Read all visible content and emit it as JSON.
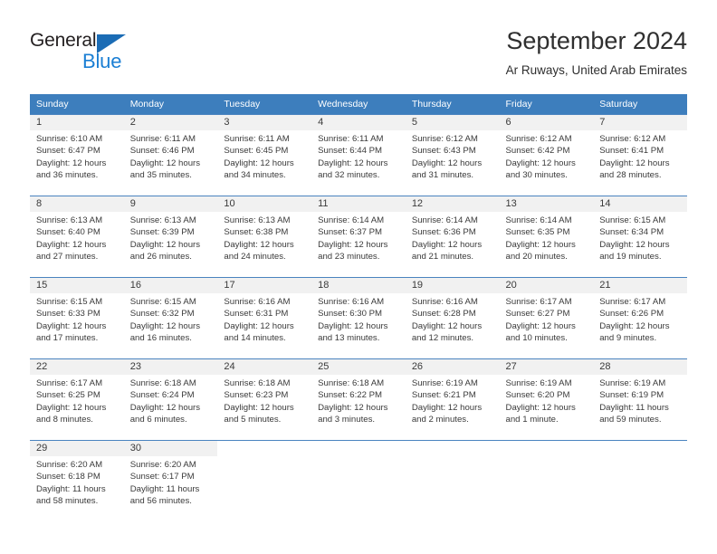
{
  "brand": {
    "name_top": "General",
    "name_bottom": "Blue",
    "triangle_color": "#1b6cb5",
    "blue_color": "#1b7fd4"
  },
  "header": {
    "title": "September 2024",
    "subtitle": "Ar Ruways, United Arab Emirates"
  },
  "colors": {
    "header_row_bg": "#3d7ebd",
    "header_row_text": "#ffffff",
    "daynum_band_bg": "#f1f1f1",
    "row_divider": "#4a83bf",
    "body_text": "#3a3a3a"
  },
  "calendar": {
    "weekdays": [
      "Sunday",
      "Monday",
      "Tuesday",
      "Wednesday",
      "Thursday",
      "Friday",
      "Saturday"
    ],
    "weeks": [
      [
        {
          "day": "1",
          "sunrise": "Sunrise: 6:10 AM",
          "sunset": "Sunset: 6:47 PM",
          "daylight_1": "Daylight: 12 hours",
          "daylight_2": "and 36 minutes."
        },
        {
          "day": "2",
          "sunrise": "Sunrise: 6:11 AM",
          "sunset": "Sunset: 6:46 PM",
          "daylight_1": "Daylight: 12 hours",
          "daylight_2": "and 35 minutes."
        },
        {
          "day": "3",
          "sunrise": "Sunrise: 6:11 AM",
          "sunset": "Sunset: 6:45 PM",
          "daylight_1": "Daylight: 12 hours",
          "daylight_2": "and 34 minutes."
        },
        {
          "day": "4",
          "sunrise": "Sunrise: 6:11 AM",
          "sunset": "Sunset: 6:44 PM",
          "daylight_1": "Daylight: 12 hours",
          "daylight_2": "and 32 minutes."
        },
        {
          "day": "5",
          "sunrise": "Sunrise: 6:12 AM",
          "sunset": "Sunset: 6:43 PM",
          "daylight_1": "Daylight: 12 hours",
          "daylight_2": "and 31 minutes."
        },
        {
          "day": "6",
          "sunrise": "Sunrise: 6:12 AM",
          "sunset": "Sunset: 6:42 PM",
          "daylight_1": "Daylight: 12 hours",
          "daylight_2": "and 30 minutes."
        },
        {
          "day": "7",
          "sunrise": "Sunrise: 6:12 AM",
          "sunset": "Sunset: 6:41 PM",
          "daylight_1": "Daylight: 12 hours",
          "daylight_2": "and 28 minutes."
        }
      ],
      [
        {
          "day": "8",
          "sunrise": "Sunrise: 6:13 AM",
          "sunset": "Sunset: 6:40 PM",
          "daylight_1": "Daylight: 12 hours",
          "daylight_2": "and 27 minutes."
        },
        {
          "day": "9",
          "sunrise": "Sunrise: 6:13 AM",
          "sunset": "Sunset: 6:39 PM",
          "daylight_1": "Daylight: 12 hours",
          "daylight_2": "and 26 minutes."
        },
        {
          "day": "10",
          "sunrise": "Sunrise: 6:13 AM",
          "sunset": "Sunset: 6:38 PM",
          "daylight_1": "Daylight: 12 hours",
          "daylight_2": "and 24 minutes."
        },
        {
          "day": "11",
          "sunrise": "Sunrise: 6:14 AM",
          "sunset": "Sunset: 6:37 PM",
          "daylight_1": "Daylight: 12 hours",
          "daylight_2": "and 23 minutes."
        },
        {
          "day": "12",
          "sunrise": "Sunrise: 6:14 AM",
          "sunset": "Sunset: 6:36 PM",
          "daylight_1": "Daylight: 12 hours",
          "daylight_2": "and 21 minutes."
        },
        {
          "day": "13",
          "sunrise": "Sunrise: 6:14 AM",
          "sunset": "Sunset: 6:35 PM",
          "daylight_1": "Daylight: 12 hours",
          "daylight_2": "and 20 minutes."
        },
        {
          "day": "14",
          "sunrise": "Sunrise: 6:15 AM",
          "sunset": "Sunset: 6:34 PM",
          "daylight_1": "Daylight: 12 hours",
          "daylight_2": "and 19 minutes."
        }
      ],
      [
        {
          "day": "15",
          "sunrise": "Sunrise: 6:15 AM",
          "sunset": "Sunset: 6:33 PM",
          "daylight_1": "Daylight: 12 hours",
          "daylight_2": "and 17 minutes."
        },
        {
          "day": "16",
          "sunrise": "Sunrise: 6:15 AM",
          "sunset": "Sunset: 6:32 PM",
          "daylight_1": "Daylight: 12 hours",
          "daylight_2": "and 16 minutes."
        },
        {
          "day": "17",
          "sunrise": "Sunrise: 6:16 AM",
          "sunset": "Sunset: 6:31 PM",
          "daylight_1": "Daylight: 12 hours",
          "daylight_2": "and 14 minutes."
        },
        {
          "day": "18",
          "sunrise": "Sunrise: 6:16 AM",
          "sunset": "Sunset: 6:30 PM",
          "daylight_1": "Daylight: 12 hours",
          "daylight_2": "and 13 minutes."
        },
        {
          "day": "19",
          "sunrise": "Sunrise: 6:16 AM",
          "sunset": "Sunset: 6:28 PM",
          "daylight_1": "Daylight: 12 hours",
          "daylight_2": "and 12 minutes."
        },
        {
          "day": "20",
          "sunrise": "Sunrise: 6:17 AM",
          "sunset": "Sunset: 6:27 PM",
          "daylight_1": "Daylight: 12 hours",
          "daylight_2": "and 10 minutes."
        },
        {
          "day": "21",
          "sunrise": "Sunrise: 6:17 AM",
          "sunset": "Sunset: 6:26 PM",
          "daylight_1": "Daylight: 12 hours",
          "daylight_2": "and 9 minutes."
        }
      ],
      [
        {
          "day": "22",
          "sunrise": "Sunrise: 6:17 AM",
          "sunset": "Sunset: 6:25 PM",
          "daylight_1": "Daylight: 12 hours",
          "daylight_2": "and 8 minutes."
        },
        {
          "day": "23",
          "sunrise": "Sunrise: 6:18 AM",
          "sunset": "Sunset: 6:24 PM",
          "daylight_1": "Daylight: 12 hours",
          "daylight_2": "and 6 minutes."
        },
        {
          "day": "24",
          "sunrise": "Sunrise: 6:18 AM",
          "sunset": "Sunset: 6:23 PM",
          "daylight_1": "Daylight: 12 hours",
          "daylight_2": "and 5 minutes."
        },
        {
          "day": "25",
          "sunrise": "Sunrise: 6:18 AM",
          "sunset": "Sunset: 6:22 PM",
          "daylight_1": "Daylight: 12 hours",
          "daylight_2": "and 3 minutes."
        },
        {
          "day": "26",
          "sunrise": "Sunrise: 6:19 AM",
          "sunset": "Sunset: 6:21 PM",
          "daylight_1": "Daylight: 12 hours",
          "daylight_2": "and 2 minutes."
        },
        {
          "day": "27",
          "sunrise": "Sunrise: 6:19 AM",
          "sunset": "Sunset: 6:20 PM",
          "daylight_1": "Daylight: 12 hours",
          "daylight_2": "and 1 minute."
        },
        {
          "day": "28",
          "sunrise": "Sunrise: 6:19 AM",
          "sunset": "Sunset: 6:19 PM",
          "daylight_1": "Daylight: 11 hours",
          "daylight_2": "and 59 minutes."
        }
      ],
      [
        {
          "day": "29",
          "sunrise": "Sunrise: 6:20 AM",
          "sunset": "Sunset: 6:18 PM",
          "daylight_1": "Daylight: 11 hours",
          "daylight_2": "and 58 minutes."
        },
        {
          "day": "30",
          "sunrise": "Sunrise: 6:20 AM",
          "sunset": "Sunset: 6:17 PM",
          "daylight_1": "Daylight: 11 hours",
          "daylight_2": "and 56 minutes."
        },
        {
          "day": "",
          "sunrise": "",
          "sunset": "",
          "daylight_1": "",
          "daylight_2": ""
        },
        {
          "day": "",
          "sunrise": "",
          "sunset": "",
          "daylight_1": "",
          "daylight_2": ""
        },
        {
          "day": "",
          "sunrise": "",
          "sunset": "",
          "daylight_1": "",
          "daylight_2": ""
        },
        {
          "day": "",
          "sunrise": "",
          "sunset": "",
          "daylight_1": "",
          "daylight_2": ""
        },
        {
          "day": "",
          "sunrise": "",
          "sunset": "",
          "daylight_1": "",
          "daylight_2": ""
        }
      ]
    ]
  }
}
